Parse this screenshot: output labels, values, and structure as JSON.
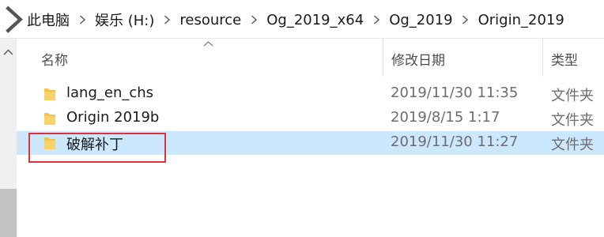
{
  "breadcrumb": {
    "items": [
      {
        "label": "此电脑"
      },
      {
        "label": "娱乐 (H:)"
      },
      {
        "label": "resource"
      },
      {
        "label": "Og_2019_x64"
      },
      {
        "label": "Og_2019"
      },
      {
        "label": "Origin_2019"
      }
    ]
  },
  "columns": {
    "name": "名称",
    "date_modified": "修改日期",
    "type": "类型"
  },
  "files": [
    {
      "name": "lang_en_chs",
      "date": "2019/11/30 11:35",
      "type": "文件夹",
      "icon": "folder-icon",
      "selected": false
    },
    {
      "name": "Origin 2019b",
      "date": "2019/8/15 1:17",
      "type": "文件夹",
      "icon": "folder-icon",
      "selected": false
    },
    {
      "name": "破解补丁",
      "date": "2019/11/30 11:27",
      "type": "文件夹",
      "icon": "folder-icon",
      "selected": true
    }
  ],
  "colors": {
    "selection": "#cce8ff",
    "highlight_border": "#e0323c",
    "folder": "#f3c24a"
  }
}
